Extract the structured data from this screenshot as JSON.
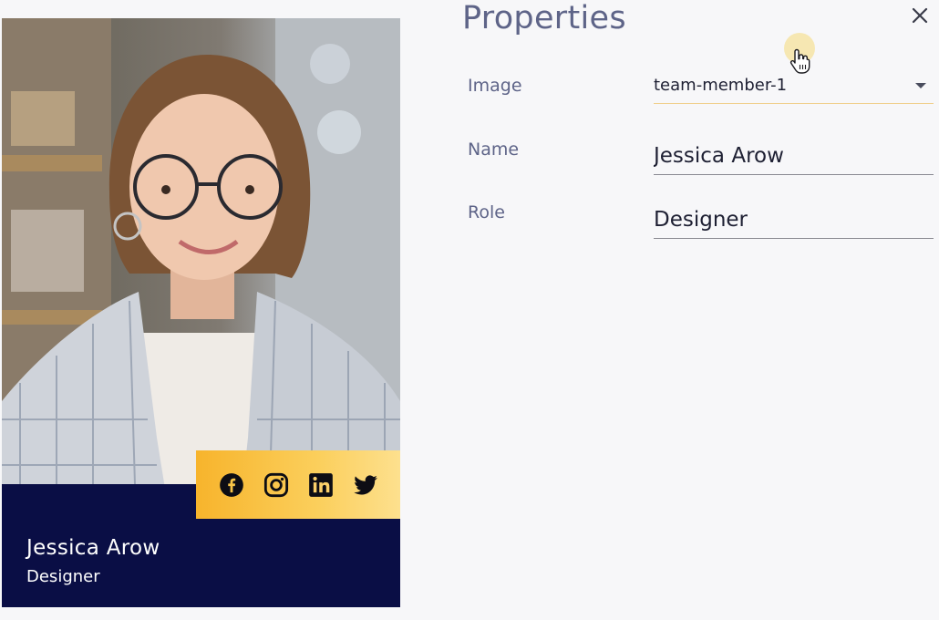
{
  "card": {
    "name": "Jessica Arow",
    "role": "Designer",
    "social_icons": [
      "facebook-icon",
      "instagram-icon",
      "linkedin-icon",
      "twitter-icon"
    ],
    "colors": {
      "info_bg": "#0a0e45",
      "social_bar_from": "#f7b42c",
      "social_bar_to": "#fde08e",
      "text": "#ffffff"
    }
  },
  "panel": {
    "title": "Properties",
    "fields": {
      "image": {
        "label": "Image",
        "value": "team-member-1"
      },
      "name": {
        "label": "Name",
        "value": "Jessica Arow"
      },
      "role": {
        "label": "Role",
        "value": "Designer"
      }
    },
    "colors": {
      "title": "#5e6488",
      "label": "#5e6488",
      "select_underline": "#f0cf8c"
    }
  }
}
